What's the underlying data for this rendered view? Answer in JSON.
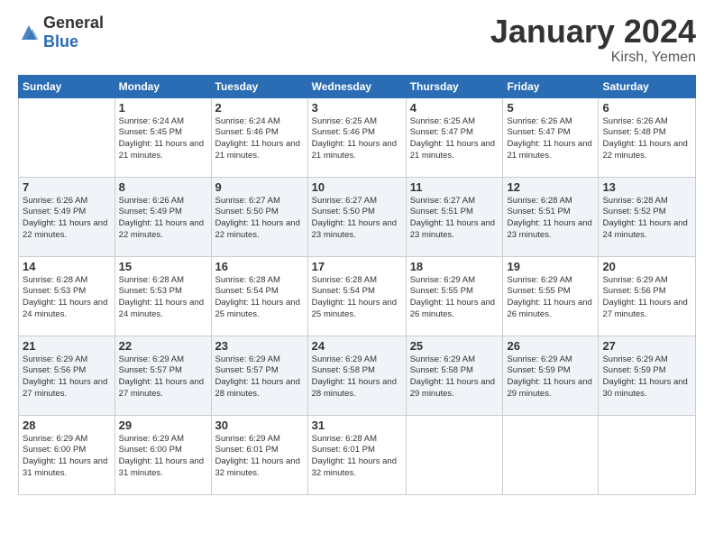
{
  "logo": {
    "general": "General",
    "blue": "Blue"
  },
  "title": "January 2024",
  "location": "Kirsh, Yemen",
  "days_of_week": [
    "Sunday",
    "Monday",
    "Tuesday",
    "Wednesday",
    "Thursday",
    "Friday",
    "Saturday"
  ],
  "weeks": [
    [
      {
        "day": "",
        "sunrise": "",
        "sunset": "",
        "daylight": ""
      },
      {
        "day": "1",
        "sunrise": "Sunrise: 6:24 AM",
        "sunset": "Sunset: 5:45 PM",
        "daylight": "Daylight: 11 hours and 21 minutes."
      },
      {
        "day": "2",
        "sunrise": "Sunrise: 6:24 AM",
        "sunset": "Sunset: 5:46 PM",
        "daylight": "Daylight: 11 hours and 21 minutes."
      },
      {
        "day": "3",
        "sunrise": "Sunrise: 6:25 AM",
        "sunset": "Sunset: 5:46 PM",
        "daylight": "Daylight: 11 hours and 21 minutes."
      },
      {
        "day": "4",
        "sunrise": "Sunrise: 6:25 AM",
        "sunset": "Sunset: 5:47 PM",
        "daylight": "Daylight: 11 hours and 21 minutes."
      },
      {
        "day": "5",
        "sunrise": "Sunrise: 6:26 AM",
        "sunset": "Sunset: 5:47 PM",
        "daylight": "Daylight: 11 hours and 21 minutes."
      },
      {
        "day": "6",
        "sunrise": "Sunrise: 6:26 AM",
        "sunset": "Sunset: 5:48 PM",
        "daylight": "Daylight: 11 hours and 22 minutes."
      }
    ],
    [
      {
        "day": "7",
        "sunrise": "Sunrise: 6:26 AM",
        "sunset": "Sunset: 5:49 PM",
        "daylight": "Daylight: 11 hours and 22 minutes."
      },
      {
        "day": "8",
        "sunrise": "Sunrise: 6:26 AM",
        "sunset": "Sunset: 5:49 PM",
        "daylight": "Daylight: 11 hours and 22 minutes."
      },
      {
        "day": "9",
        "sunrise": "Sunrise: 6:27 AM",
        "sunset": "Sunset: 5:50 PM",
        "daylight": "Daylight: 11 hours and 22 minutes."
      },
      {
        "day": "10",
        "sunrise": "Sunrise: 6:27 AM",
        "sunset": "Sunset: 5:50 PM",
        "daylight": "Daylight: 11 hours and 23 minutes."
      },
      {
        "day": "11",
        "sunrise": "Sunrise: 6:27 AM",
        "sunset": "Sunset: 5:51 PM",
        "daylight": "Daylight: 11 hours and 23 minutes."
      },
      {
        "day": "12",
        "sunrise": "Sunrise: 6:28 AM",
        "sunset": "Sunset: 5:51 PM",
        "daylight": "Daylight: 11 hours and 23 minutes."
      },
      {
        "day": "13",
        "sunrise": "Sunrise: 6:28 AM",
        "sunset": "Sunset: 5:52 PM",
        "daylight": "Daylight: 11 hours and 24 minutes."
      }
    ],
    [
      {
        "day": "14",
        "sunrise": "Sunrise: 6:28 AM",
        "sunset": "Sunset: 5:53 PM",
        "daylight": "Daylight: 11 hours and 24 minutes."
      },
      {
        "day": "15",
        "sunrise": "Sunrise: 6:28 AM",
        "sunset": "Sunset: 5:53 PM",
        "daylight": "Daylight: 11 hours and 24 minutes."
      },
      {
        "day": "16",
        "sunrise": "Sunrise: 6:28 AM",
        "sunset": "Sunset: 5:54 PM",
        "daylight": "Daylight: 11 hours and 25 minutes."
      },
      {
        "day": "17",
        "sunrise": "Sunrise: 6:28 AM",
        "sunset": "Sunset: 5:54 PM",
        "daylight": "Daylight: 11 hours and 25 minutes."
      },
      {
        "day": "18",
        "sunrise": "Sunrise: 6:29 AM",
        "sunset": "Sunset: 5:55 PM",
        "daylight": "Daylight: 11 hours and 26 minutes."
      },
      {
        "day": "19",
        "sunrise": "Sunrise: 6:29 AM",
        "sunset": "Sunset: 5:55 PM",
        "daylight": "Daylight: 11 hours and 26 minutes."
      },
      {
        "day": "20",
        "sunrise": "Sunrise: 6:29 AM",
        "sunset": "Sunset: 5:56 PM",
        "daylight": "Daylight: 11 hours and 27 minutes."
      }
    ],
    [
      {
        "day": "21",
        "sunrise": "Sunrise: 6:29 AM",
        "sunset": "Sunset: 5:56 PM",
        "daylight": "Daylight: 11 hours and 27 minutes."
      },
      {
        "day": "22",
        "sunrise": "Sunrise: 6:29 AM",
        "sunset": "Sunset: 5:57 PM",
        "daylight": "Daylight: 11 hours and 27 minutes."
      },
      {
        "day": "23",
        "sunrise": "Sunrise: 6:29 AM",
        "sunset": "Sunset: 5:57 PM",
        "daylight": "Daylight: 11 hours and 28 minutes."
      },
      {
        "day": "24",
        "sunrise": "Sunrise: 6:29 AM",
        "sunset": "Sunset: 5:58 PM",
        "daylight": "Daylight: 11 hours and 28 minutes."
      },
      {
        "day": "25",
        "sunrise": "Sunrise: 6:29 AM",
        "sunset": "Sunset: 5:58 PM",
        "daylight": "Daylight: 11 hours and 29 minutes."
      },
      {
        "day": "26",
        "sunrise": "Sunrise: 6:29 AM",
        "sunset": "Sunset: 5:59 PM",
        "daylight": "Daylight: 11 hours and 29 minutes."
      },
      {
        "day": "27",
        "sunrise": "Sunrise: 6:29 AM",
        "sunset": "Sunset: 5:59 PM",
        "daylight": "Daylight: 11 hours and 30 minutes."
      }
    ],
    [
      {
        "day": "28",
        "sunrise": "Sunrise: 6:29 AM",
        "sunset": "Sunset: 6:00 PM",
        "daylight": "Daylight: 11 hours and 31 minutes."
      },
      {
        "day": "29",
        "sunrise": "Sunrise: 6:29 AM",
        "sunset": "Sunset: 6:00 PM",
        "daylight": "Daylight: 11 hours and 31 minutes."
      },
      {
        "day": "30",
        "sunrise": "Sunrise: 6:29 AM",
        "sunset": "Sunset: 6:01 PM",
        "daylight": "Daylight: 11 hours and 32 minutes."
      },
      {
        "day": "31",
        "sunrise": "Sunrise: 6:28 AM",
        "sunset": "Sunset: 6:01 PM",
        "daylight": "Daylight: 11 hours and 32 minutes."
      },
      {
        "day": "",
        "sunrise": "",
        "sunset": "",
        "daylight": ""
      },
      {
        "day": "",
        "sunrise": "",
        "sunset": "",
        "daylight": ""
      },
      {
        "day": "",
        "sunrise": "",
        "sunset": "",
        "daylight": ""
      }
    ]
  ]
}
